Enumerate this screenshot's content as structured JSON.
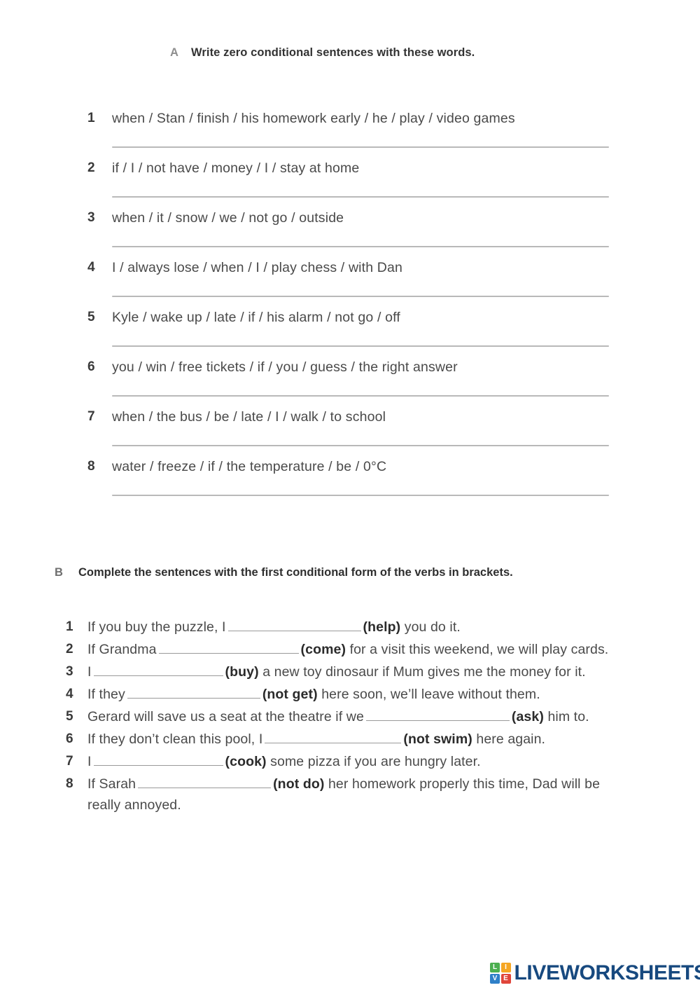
{
  "sections": {
    "a": {
      "letter": "A",
      "heading": "Write zero conditional sentences with these words.",
      "items": [
        {
          "number": "1",
          "text": "when / Stan / finish / his homework early / he / play / video games"
        },
        {
          "number": "2",
          "text": "if / I / not have / money / I / stay at home"
        },
        {
          "number": "3",
          "text": "when / it / snow / we / not go / outside"
        },
        {
          "number": "4",
          "text": "I / always lose / when / I / play chess / with Dan"
        },
        {
          "number": "5",
          "text": "Kyle / wake up / late / if / his alarm / not go / off"
        },
        {
          "number": "6",
          "text": "you / win / free tickets / if / you / guess / the right answer"
        },
        {
          "number": "7",
          "text": "when / the bus / be / late / I / walk / to school"
        },
        {
          "number": "8",
          "text": "water / freeze / if / the temperature / be / 0°C"
        }
      ]
    },
    "b": {
      "letter": "B",
      "heading": "Complete the sentences with the first conditional form of the verbs in brackets.",
      "items": [
        {
          "number": "1",
          "before": "If you buy the puzzle, I",
          "verb": "(help)",
          "after": " you do it."
        },
        {
          "number": "2",
          "before": "If Grandma",
          "verb": "(come)",
          "after": " for a visit this weekend, we will play cards."
        },
        {
          "number": "3",
          "before": "I",
          "verb": "(buy)",
          "after": " a new toy dinosaur if Mum gives me the money for it."
        },
        {
          "number": "4",
          "before": "If they",
          "verb": "(not get)",
          "after": " here soon, we’ll leave without them."
        },
        {
          "number": "5",
          "before": "Gerard will save us a seat at the theatre if we",
          "verb": "(ask)",
          "after": " him to."
        },
        {
          "number": "6",
          "before": "If they don’t clean this pool, I",
          "verb": "(not swim)",
          "after": " here again."
        },
        {
          "number": "7",
          "before": "I",
          "verb": "(cook)",
          "after": " some pizza if you are hungry later."
        },
        {
          "number": "8",
          "before": "If Sarah",
          "verb": "(not do)",
          "after": " her homework properly this time, Dad will be really annoyed."
        }
      ]
    }
  },
  "logo": {
    "tiles": [
      "L",
      "I",
      "V",
      "E"
    ],
    "word": "LIVEWORKSHEETS",
    "colors": {
      "l": "#4caf50",
      "i": "#f5a623",
      "v": "#2f80c8",
      "e": "#e0453a",
      "word": "#17497f"
    }
  }
}
